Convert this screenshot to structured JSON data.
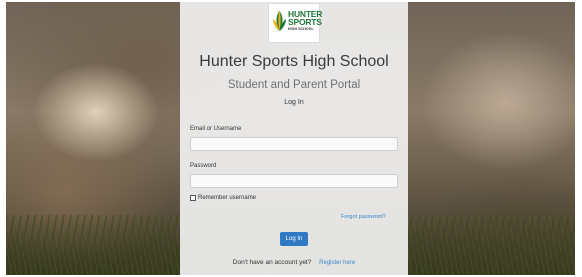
{
  "logo": {
    "line1": "HUNTER",
    "line2": "SPORTS",
    "line3": "HIGH SCHOOL",
    "icon": "hunter-sports-logo-icon",
    "brand_green": "#1f7a3a",
    "brand_yellow": "#f2b21c"
  },
  "school_name": "Hunter Sports High School",
  "portal_name": "Student and Parent Portal",
  "form": {
    "heading": "Log In",
    "username_label": "Email or Username",
    "username_value": "",
    "password_label": "Password",
    "password_value": "",
    "remember_label": "Remember username",
    "remember_checked": false,
    "forgot_link": "Forgot password?",
    "submit_label": "Log In"
  },
  "footer": {
    "prompt": "Don't have an account yet?",
    "register_link": "Register here"
  },
  "colors": {
    "accent": "#2e79c2",
    "link": "#3a86c8"
  }
}
